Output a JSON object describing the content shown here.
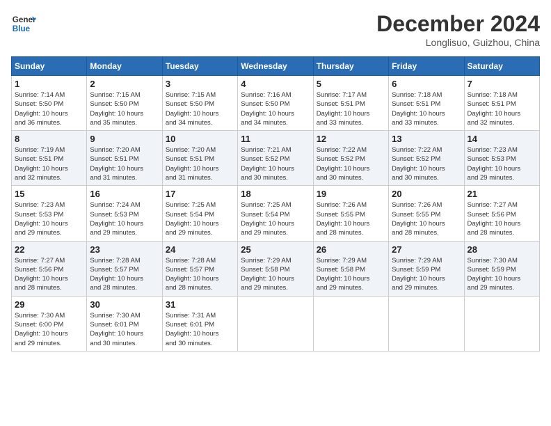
{
  "header": {
    "logo_line1": "General",
    "logo_line2": "Blue",
    "month": "December 2024",
    "location": "Longlisuo, Guizhou, China"
  },
  "weekdays": [
    "Sunday",
    "Monday",
    "Tuesday",
    "Wednesday",
    "Thursday",
    "Friday",
    "Saturday"
  ],
  "weeks": [
    [
      {
        "day": "1",
        "info": "Sunrise: 7:14 AM\nSunset: 5:50 PM\nDaylight: 10 hours\nand 36 minutes."
      },
      {
        "day": "2",
        "info": "Sunrise: 7:15 AM\nSunset: 5:50 PM\nDaylight: 10 hours\nand 35 minutes."
      },
      {
        "day": "3",
        "info": "Sunrise: 7:15 AM\nSunset: 5:50 PM\nDaylight: 10 hours\nand 34 minutes."
      },
      {
        "day": "4",
        "info": "Sunrise: 7:16 AM\nSunset: 5:50 PM\nDaylight: 10 hours\nand 34 minutes."
      },
      {
        "day": "5",
        "info": "Sunrise: 7:17 AM\nSunset: 5:51 PM\nDaylight: 10 hours\nand 33 minutes."
      },
      {
        "day": "6",
        "info": "Sunrise: 7:18 AM\nSunset: 5:51 PM\nDaylight: 10 hours\nand 33 minutes."
      },
      {
        "day": "7",
        "info": "Sunrise: 7:18 AM\nSunset: 5:51 PM\nDaylight: 10 hours\nand 32 minutes."
      }
    ],
    [
      {
        "day": "8",
        "info": "Sunrise: 7:19 AM\nSunset: 5:51 PM\nDaylight: 10 hours\nand 32 minutes."
      },
      {
        "day": "9",
        "info": "Sunrise: 7:20 AM\nSunset: 5:51 PM\nDaylight: 10 hours\nand 31 minutes."
      },
      {
        "day": "10",
        "info": "Sunrise: 7:20 AM\nSunset: 5:51 PM\nDaylight: 10 hours\nand 31 minutes."
      },
      {
        "day": "11",
        "info": "Sunrise: 7:21 AM\nSunset: 5:52 PM\nDaylight: 10 hours\nand 30 minutes."
      },
      {
        "day": "12",
        "info": "Sunrise: 7:22 AM\nSunset: 5:52 PM\nDaylight: 10 hours\nand 30 minutes."
      },
      {
        "day": "13",
        "info": "Sunrise: 7:22 AM\nSunset: 5:52 PM\nDaylight: 10 hours\nand 30 minutes."
      },
      {
        "day": "14",
        "info": "Sunrise: 7:23 AM\nSunset: 5:53 PM\nDaylight: 10 hours\nand 29 minutes."
      }
    ],
    [
      {
        "day": "15",
        "info": "Sunrise: 7:23 AM\nSunset: 5:53 PM\nDaylight: 10 hours\nand 29 minutes."
      },
      {
        "day": "16",
        "info": "Sunrise: 7:24 AM\nSunset: 5:53 PM\nDaylight: 10 hours\nand 29 minutes."
      },
      {
        "day": "17",
        "info": "Sunrise: 7:25 AM\nSunset: 5:54 PM\nDaylight: 10 hours\nand 29 minutes."
      },
      {
        "day": "18",
        "info": "Sunrise: 7:25 AM\nSunset: 5:54 PM\nDaylight: 10 hours\nand 29 minutes."
      },
      {
        "day": "19",
        "info": "Sunrise: 7:26 AM\nSunset: 5:55 PM\nDaylight: 10 hours\nand 28 minutes."
      },
      {
        "day": "20",
        "info": "Sunrise: 7:26 AM\nSunset: 5:55 PM\nDaylight: 10 hours\nand 28 minutes."
      },
      {
        "day": "21",
        "info": "Sunrise: 7:27 AM\nSunset: 5:56 PM\nDaylight: 10 hours\nand 28 minutes."
      }
    ],
    [
      {
        "day": "22",
        "info": "Sunrise: 7:27 AM\nSunset: 5:56 PM\nDaylight: 10 hours\nand 28 minutes."
      },
      {
        "day": "23",
        "info": "Sunrise: 7:28 AM\nSunset: 5:57 PM\nDaylight: 10 hours\nand 28 minutes."
      },
      {
        "day": "24",
        "info": "Sunrise: 7:28 AM\nSunset: 5:57 PM\nDaylight: 10 hours\nand 28 minutes."
      },
      {
        "day": "25",
        "info": "Sunrise: 7:29 AM\nSunset: 5:58 PM\nDaylight: 10 hours\nand 29 minutes."
      },
      {
        "day": "26",
        "info": "Sunrise: 7:29 AM\nSunset: 5:58 PM\nDaylight: 10 hours\nand 29 minutes."
      },
      {
        "day": "27",
        "info": "Sunrise: 7:29 AM\nSunset: 5:59 PM\nDaylight: 10 hours\nand 29 minutes."
      },
      {
        "day": "28",
        "info": "Sunrise: 7:30 AM\nSunset: 5:59 PM\nDaylight: 10 hours\nand 29 minutes."
      }
    ],
    [
      {
        "day": "29",
        "info": "Sunrise: 7:30 AM\nSunset: 6:00 PM\nDaylight: 10 hours\nand 29 minutes."
      },
      {
        "day": "30",
        "info": "Sunrise: 7:30 AM\nSunset: 6:01 PM\nDaylight: 10 hours\nand 30 minutes."
      },
      {
        "day": "31",
        "info": "Sunrise: 7:31 AM\nSunset: 6:01 PM\nDaylight: 10 hours\nand 30 minutes."
      },
      null,
      null,
      null,
      null
    ]
  ]
}
